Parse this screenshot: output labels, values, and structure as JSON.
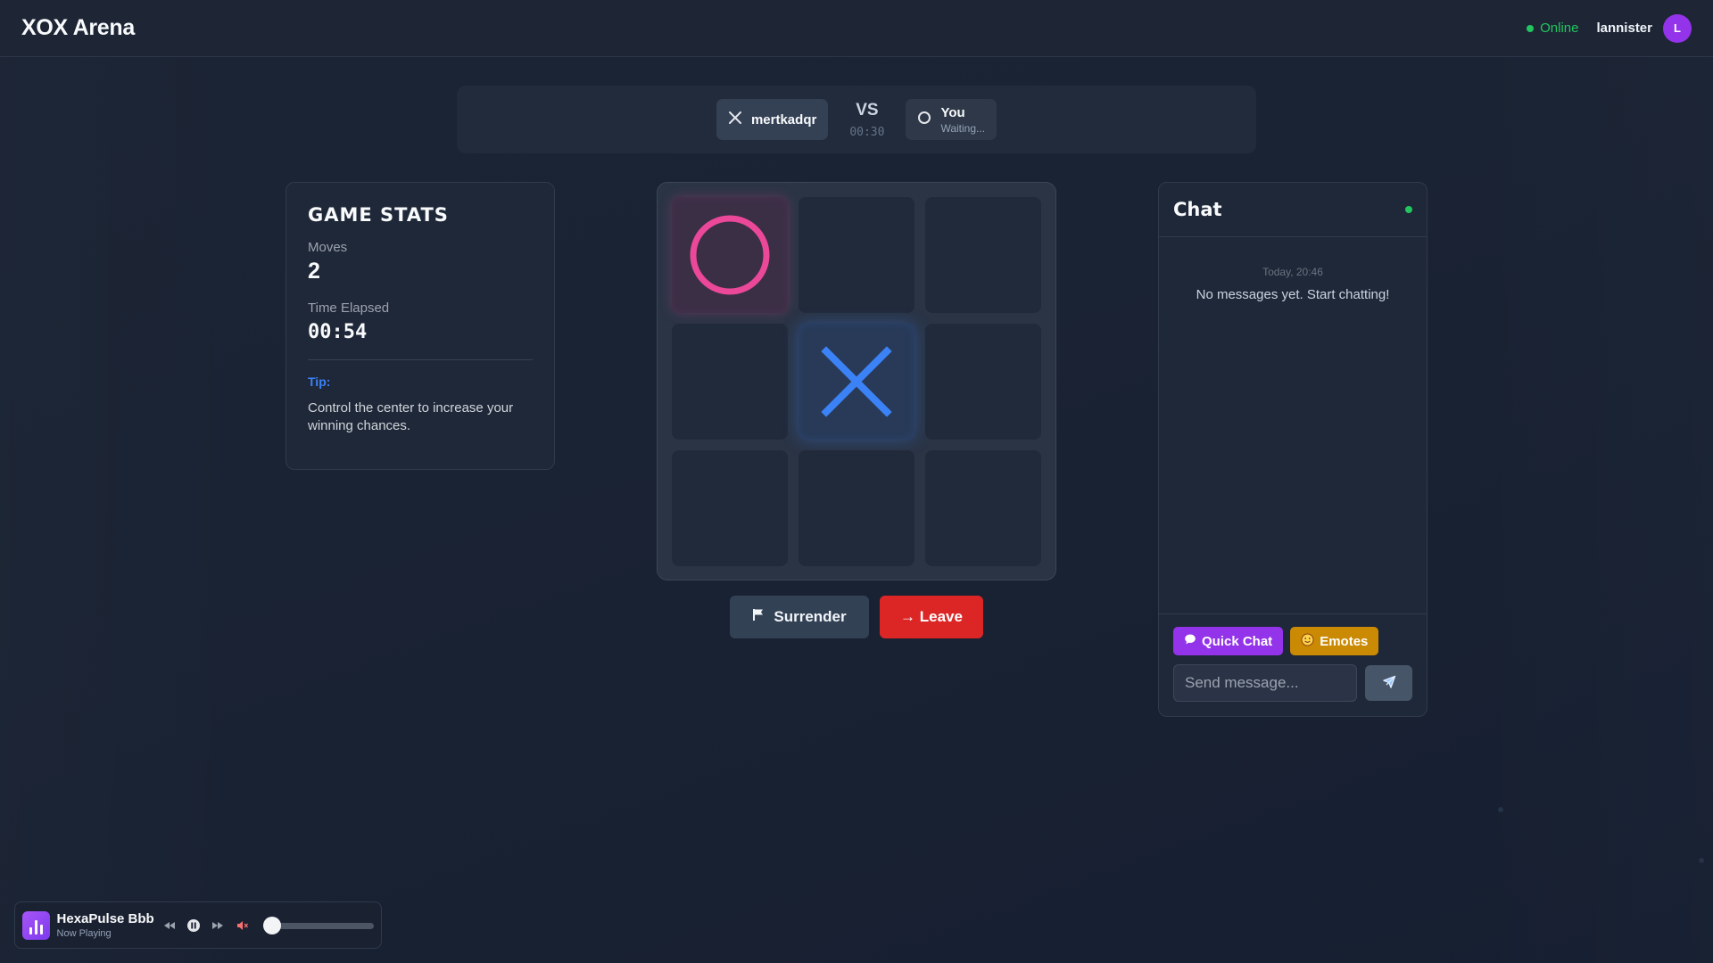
{
  "header": {
    "brand": "XOX Arena",
    "status": "Online",
    "username": "lannister",
    "avatar_initial": "L"
  },
  "match": {
    "opponent": {
      "name": "mertkadqr",
      "mark": "x-icon"
    },
    "vs_label": "VS",
    "turn_timer": "00:30",
    "you": {
      "name": "You",
      "status": "Waiting...",
      "mark": "o-icon"
    }
  },
  "stats": {
    "title": "GAME STATS",
    "moves_label": "Moves",
    "moves_value": "2",
    "time_label": "Time Elapsed",
    "time_value": "00:54",
    "tip_label": "Tip:",
    "tip_text": "Control the center to increase your winning chances."
  },
  "board": {
    "cells": [
      "O",
      "",
      "",
      "",
      "X",
      "",
      "",
      "",
      ""
    ],
    "colors": {
      "o": "#ec4899",
      "x": "#3b82f6"
    }
  },
  "actions": {
    "surrender_label": "Surrender",
    "leave_label": "→ Leave"
  },
  "chat": {
    "title": "Chat",
    "date": "Today, 20:46",
    "empty_text": "No messages yet. Start chatting!",
    "quick_chat_label": "Quick Chat",
    "emotes_label": "Emotes",
    "input_placeholder": "Send message..."
  },
  "player": {
    "track_title": "HexaPulse Bbb",
    "track_status": "Now Playing",
    "volume": 0
  }
}
